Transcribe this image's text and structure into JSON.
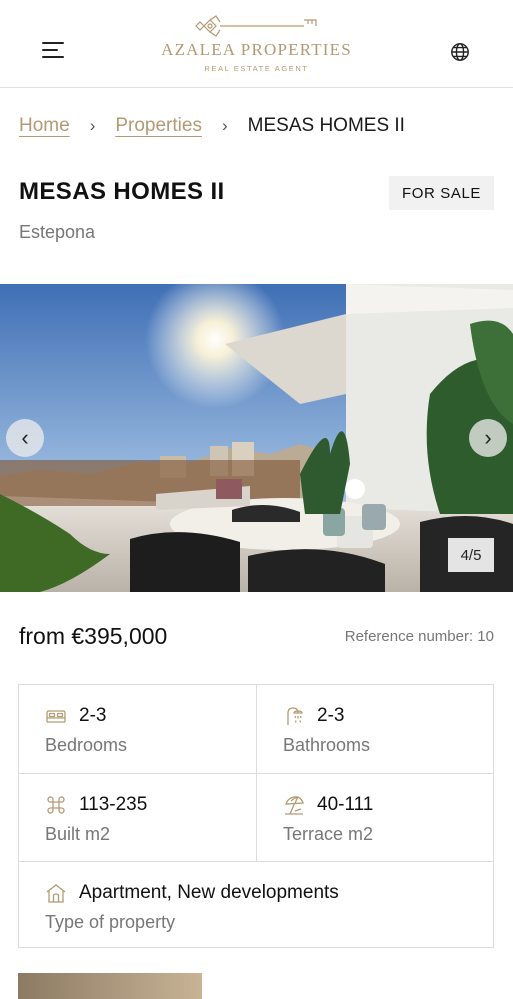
{
  "header": {
    "brand_name": "AZALEA PROPERTIES",
    "brand_tagline": "REAL ESTATE AGENT",
    "menu_icon": "hamburger-menu-icon",
    "language_icon": "globe-icon",
    "brand_color": "#b39a73"
  },
  "breadcrumb": {
    "home": "Home",
    "properties": "Properties",
    "current": "MESAS HOMES II",
    "separator": "›"
  },
  "property": {
    "title": "MESAS HOMES II",
    "status": "FOR SALE",
    "location": "Estepona",
    "price": "from €395,000",
    "reference": "Reference number: 10"
  },
  "gallery": {
    "prev": "‹",
    "next": "›",
    "counter": "4/5"
  },
  "specs": {
    "bedrooms": {
      "value": "2-3",
      "label": "Bedrooms",
      "icon": "bed-icon"
    },
    "bathrooms": {
      "value": "2-3",
      "label": "Bathrooms",
      "icon": "shower-icon"
    },
    "built": {
      "value": "113-235",
      "label": "Built m2",
      "icon": "command-key-icon"
    },
    "terrace": {
      "value": "40-111",
      "label": "Terrace m2",
      "icon": "beach-umbrella-icon"
    },
    "type": {
      "value": "Apartment, New developments",
      "label": "Type of property",
      "icon": "house-icon"
    }
  }
}
